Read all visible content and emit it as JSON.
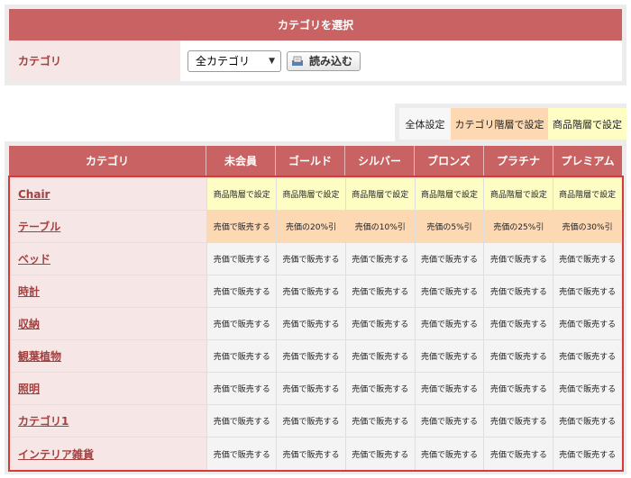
{
  "selector": {
    "header": "カテゴリを選択",
    "label": "カテゴリ",
    "select_value": "全カテゴリ",
    "load_label": "読み込む"
  },
  "legend": {
    "all": "全体設定",
    "category": "カテゴリ階層で設定",
    "product": "商品階層で設定"
  },
  "colors": {
    "header": "#c96262",
    "label_bg": "#f6e6e6",
    "product_level": "#fdfdc4",
    "category_level": "#fdd9b3",
    "global": "#f4f4f4",
    "selection_border": "#d63a3a"
  },
  "grid": {
    "columns": [
      "カテゴリ",
      "未会員",
      "ゴールド",
      "シルバー",
      "ブロンズ",
      "プラチナ",
      "プレミアム"
    ],
    "rows": [
      {
        "name": "Chair",
        "level": "product",
        "values": [
          "商品階層で設定",
          "商品階層で設定",
          "商品階層で設定",
          "商品階層で設定",
          "商品階層で設定",
          "商品階層で設定"
        ]
      },
      {
        "name": "テーブル",
        "level": "category",
        "values": [
          "売価で販売する",
          "売価の20%引",
          "売価の10%引",
          "売価の5%引",
          "売価の25%引",
          "売価の30%引"
        ]
      },
      {
        "name": "ベッド",
        "level": "all",
        "values": [
          "売価で販売する",
          "売価で販売する",
          "売価で販売する",
          "売価で販売する",
          "売価で販売する",
          "売価で販売する"
        ]
      },
      {
        "name": "時計",
        "level": "all",
        "values": [
          "売価で販売する",
          "売価で販売する",
          "売価で販売する",
          "売価で販売する",
          "売価で販売する",
          "売価で販売する"
        ]
      },
      {
        "name": "収納",
        "level": "all",
        "values": [
          "売価で販売する",
          "売価で販売する",
          "売価で販売する",
          "売価で販売する",
          "売価で販売する",
          "売価で販売する"
        ]
      },
      {
        "name": "観葉植物",
        "level": "all",
        "values": [
          "売価で販売する",
          "売価で販売する",
          "売価で販売する",
          "売価で販売する",
          "売価で販売する",
          "売価で販売する"
        ]
      },
      {
        "name": "照明",
        "level": "all",
        "values": [
          "売価で販売する",
          "売価で販売する",
          "売価で販売する",
          "売価で販売する",
          "売価で販売する",
          "売価で販売する"
        ]
      },
      {
        "name": "カテゴリ1",
        "level": "all",
        "values": [
          "売価で販売する",
          "売価で販売する",
          "売価で販売する",
          "売価で販売する",
          "売価で販売する",
          "売価で販売する"
        ]
      },
      {
        "name": "インテリア雑貨",
        "level": "all",
        "values": [
          "売価で販売する",
          "売価で販売する",
          "売価で販売する",
          "売価で販売する",
          "売価で販売する",
          "売価で販売する"
        ]
      }
    ]
  }
}
